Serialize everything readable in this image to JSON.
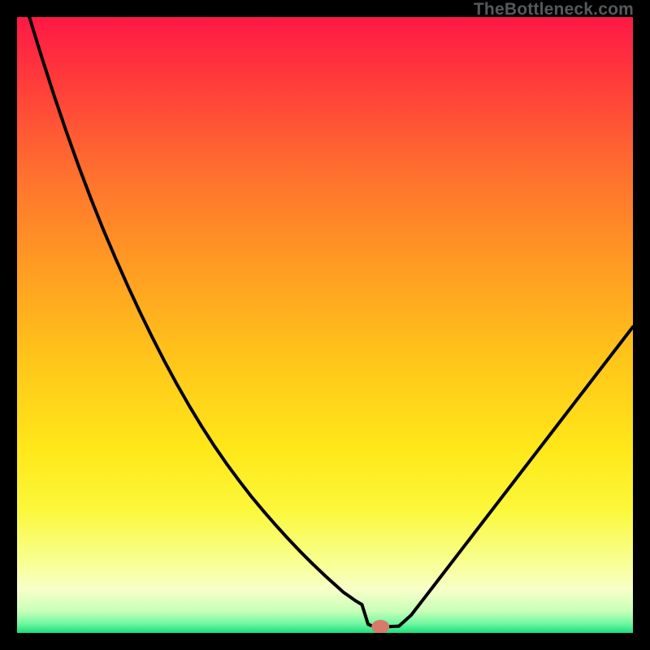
{
  "watermark": "TheBottleneck.com",
  "chart_data": {
    "type": "line",
    "title": "",
    "xlabel": "",
    "ylabel": "",
    "xlim": [
      0,
      100
    ],
    "ylim": [
      0,
      100
    ],
    "grid": false,
    "legend": false,
    "x": [
      0,
      2,
      4,
      6,
      8,
      10,
      12,
      14,
      16,
      18,
      20,
      22,
      24,
      26,
      28,
      30,
      32,
      34,
      36,
      38,
      40,
      42,
      44,
      46,
      48,
      50,
      51,
      52,
      53,
      54,
      55,
      56,
      57,
      58,
      60,
      62,
      64,
      66,
      68,
      70,
      72,
      74,
      76,
      78,
      80,
      82,
      84,
      86,
      88,
      90,
      92,
      94,
      96,
      98,
      100
    ],
    "values": [
      null,
      100,
      93.5,
      87.3,
      81.4,
      75.8,
      70.5,
      65.5,
      60.8,
      56.3,
      52.0,
      47.9,
      44.0,
      40.3,
      36.8,
      33.5,
      30.4,
      27.5,
      24.8,
      22.2,
      19.8,
      17.5,
      15.3,
      13.2,
      11.2,
      9.3,
      8.4,
      7.5,
      6.6,
      5.9,
      5.2,
      4.6,
      1.4,
      1.0,
      1.0,
      1.1,
      2.9,
      5.5,
      8.1,
      10.7,
      13.3,
      15.9,
      18.5,
      21.1,
      23.7,
      26.3,
      28.9,
      31.5,
      34.1,
      36.7,
      39.3,
      41.9,
      44.5,
      47.1,
      49.7
    ],
    "marker": {
      "x": 59,
      "y": 1
    },
    "colors": {
      "curve": "#000000",
      "marker": "#d77a6b"
    },
    "background_gradient": [
      "#ff1845",
      "#ff3a3b",
      "#ff6f2f",
      "#ff9a23",
      "#ffc41a",
      "#ffe719",
      "#fbf83a",
      "#f8ff8c",
      "#f7ffc8",
      "#c7ffb8",
      "#70f7a0",
      "#18e07d"
    ]
  }
}
